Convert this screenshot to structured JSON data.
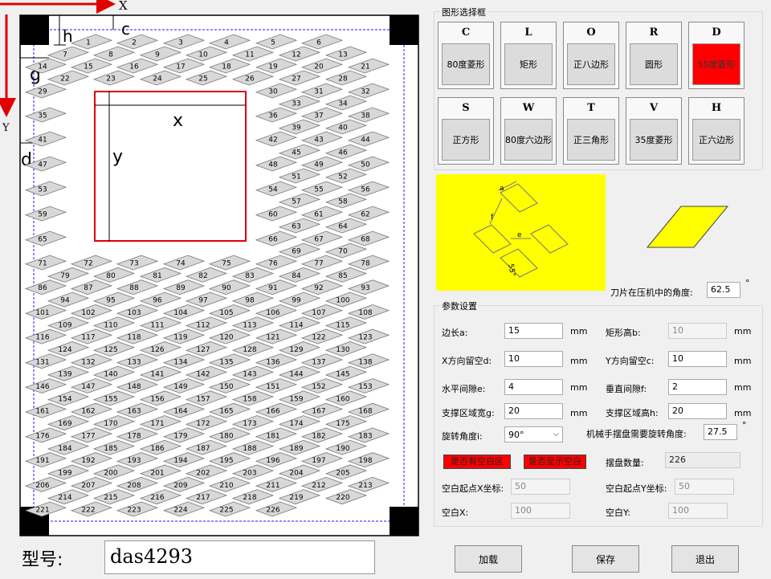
{
  "diagram": {
    "axis_x": "X",
    "axis_y": "Y",
    "dim_h": "h",
    "dim_c": "c",
    "dim_g": "g",
    "dim_d": "d",
    "blank_x": "x",
    "blank_y": "y",
    "piece_count": 226
  },
  "model": {
    "label": "型号:",
    "value": "das4293"
  },
  "shape_group": {
    "title": "图形选择框",
    "buttons": [
      {
        "letter": "C",
        "label": "80度菱形",
        "selected": false
      },
      {
        "letter": "L",
        "label": "矩形",
        "selected": false
      },
      {
        "letter": "O",
        "label": "正八边形",
        "selected": false
      },
      {
        "letter": "R",
        "label": "圆形",
        "selected": false
      },
      {
        "letter": "D",
        "label": "55度菱形",
        "selected": true
      },
      {
        "letter": "S",
        "label": "正方形",
        "selected": false
      },
      {
        "letter": "W",
        "label": "80度六边形",
        "selected": false
      },
      {
        "letter": "T",
        "label": "正三角形",
        "selected": false
      },
      {
        "letter": "V",
        "label": "35度菱形",
        "selected": false
      },
      {
        "letter": "H",
        "label": "正六边形",
        "selected": false
      }
    ]
  },
  "preview": {
    "label_a": "a",
    "label_f": "f",
    "label_e": "e",
    "label_angle": "55°",
    "blade_angle_label": "刀片在压机中的角度:",
    "blade_angle_value": "62.5",
    "degree": "°",
    "accent_color": "#ffff00"
  },
  "params": {
    "title": "参数设置",
    "side_a": {
      "label": "边长a:",
      "value": "15",
      "unit": "mm"
    },
    "rect_b": {
      "label": "矩形高b:",
      "value": "10",
      "unit": "mm"
    },
    "x_margin_d": {
      "label": "X方向留空d:",
      "value": "10",
      "unit": "mm"
    },
    "y_margin_c": {
      "label": "Y方向留空c:",
      "value": "10",
      "unit": "mm"
    },
    "h_gap_e": {
      "label": "水平间隙e:",
      "value": "4",
      "unit": "mm"
    },
    "v_gap_f": {
      "label": "垂直间隙f:",
      "value": "2",
      "unit": "mm"
    },
    "support_w_g": {
      "label": "支撑区域宽g:",
      "value": "20",
      "unit": "mm"
    },
    "support_h_h": {
      "label": "支撑区域高h:",
      "value": "20",
      "unit": "mm"
    },
    "rotation_i": {
      "label": "旋转角度i:",
      "value": "90°"
    },
    "robot_rotation": {
      "label": "机械手摆盘需要旋转角度:",
      "value": "27.5",
      "unit": "°"
    },
    "has_blank_btn": "是否有空白区",
    "show_blank_btn": "是否显示空白",
    "tray_count": {
      "label": "摆盘数量:",
      "value": "226"
    },
    "blank_start_x": {
      "label": "空白起点X坐标:",
      "value": "50"
    },
    "blank_start_y": {
      "label": "空白起点Y坐标:",
      "value": "50"
    },
    "blank_x": {
      "label": "空白X:",
      "value": "100"
    },
    "blank_y": {
      "label": "空白Y:",
      "value": "100"
    }
  },
  "actions": {
    "load": "加载",
    "save": "保存",
    "exit": "退出"
  }
}
